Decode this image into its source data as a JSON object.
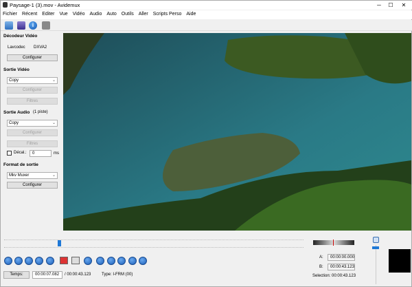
{
  "window": {
    "title": "Paysage-1 (3).mov - Avidemux",
    "minimize": "─",
    "maximize": "☐",
    "close": "✕"
  },
  "menu": [
    "Fichier",
    "Récent",
    "Editer",
    "Vue",
    "Vidéo",
    "Audio",
    "Auto",
    "Outils",
    "Aller",
    "Scripts Perso",
    "Aide"
  ],
  "toolbar": {
    "icons": [
      "open-icon",
      "save-icon",
      "info-icon",
      "calculator-icon"
    ]
  },
  "left": {
    "decoder": {
      "heading": "Décodeur Vidéo",
      "codec": "Lavcodec",
      "accel": "DXVA2",
      "configure": "Configurer"
    },
    "video_out": {
      "heading": "Sortie Vidéo",
      "codec": "Copy",
      "configure": "Configurer",
      "filters": "Filtres"
    },
    "audio_out": {
      "heading": "Sortie Audio",
      "tracks": "(1 piste)",
      "codec": "Copy",
      "configure": "Configurer",
      "filters": "Filtres",
      "shift_label": "Décal.:",
      "shift_value": "0",
      "shift_unit": "ms",
      "shift_checked": false
    },
    "format": {
      "heading": "Format de sortie",
      "muxer": "Mkv Muxer",
      "configure": "Configurer"
    }
  },
  "timeline": {
    "position_fraction": 0.18
  },
  "controls": {
    "time_button": "Temps:",
    "current_time": "00:00:07.082",
    "total_time": "/ 00:00:43.123",
    "frame_type": "Type:  I-FRM (00)"
  },
  "selection": {
    "a_label": "A:",
    "a_value": "00:00:00.000",
    "b_label": "B:",
    "b_value": "00:00:43.123",
    "selection_text": "Selection: 00:00:43.123"
  }
}
